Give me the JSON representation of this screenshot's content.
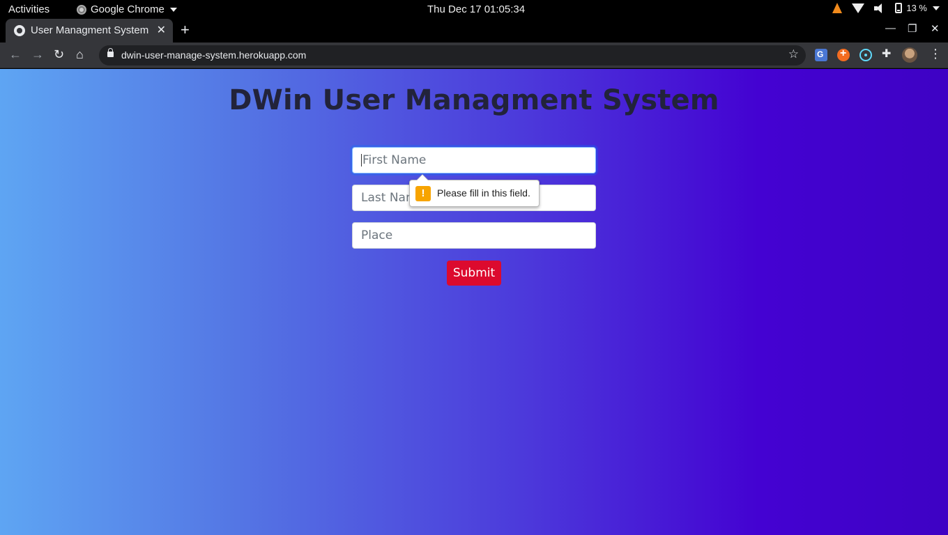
{
  "system_bar": {
    "activities": "Activities",
    "app_name": "Google Chrome",
    "clock": "Thu Dec 17  01:05:34",
    "battery": "13 %"
  },
  "browser": {
    "tab_title": "User Managment System",
    "url": "dwin-user-manage-system.herokuapp.com"
  },
  "page": {
    "title": "DWin User Managment System",
    "form": {
      "first_name_placeholder": "First Name",
      "last_name_placeholder": "Last Name",
      "place_placeholder": "Place",
      "submit_label": "Submit"
    },
    "validation_message": "Please fill in this field."
  },
  "colors": {
    "submit": "#dc0a2e",
    "gradient_start": "#5ea5f3",
    "gradient_end": "#3e02c4",
    "warning": "#f7a400"
  }
}
